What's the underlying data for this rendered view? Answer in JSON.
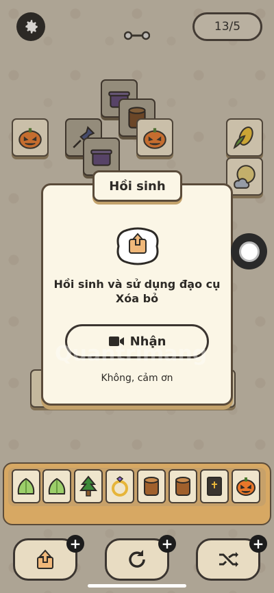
{
  "header": {
    "settings_icon": "gear-icon",
    "level_text": "13/5",
    "progress_icon": "link-progress-icon"
  },
  "board": {
    "tiles": [
      {
        "icon": "pumpkin-icon"
      },
      {
        "icon": "pot-icon"
      },
      {
        "icon": "log-icon"
      },
      {
        "icon": "pin-icon"
      },
      {
        "icon": "pot-icon"
      },
      {
        "icon": "pumpkin-icon"
      },
      {
        "icon": "corn-icon"
      },
      {
        "icon": "moon-cloud-icon"
      }
    ]
  },
  "modal": {
    "title": "Hồi sinh",
    "description": "Hồi sinh và sử dụng đạo cụ Xóa bỏ",
    "booster_icon": "undo-booster-icon",
    "receive_label": "Nhận",
    "receive_icon": "video-camera-icon",
    "decline_label": "Không, cảm ơn"
  },
  "tray": {
    "items": [
      {
        "icon": "lettuce-icon"
      },
      {
        "icon": "lettuce-icon"
      },
      {
        "icon": "tree-icon"
      },
      {
        "icon": "ring-icon"
      },
      {
        "icon": "log-icon"
      },
      {
        "icon": "log-icon"
      },
      {
        "icon": "book-icon"
      },
      {
        "icon": "pumpkin-icon"
      }
    ]
  },
  "tools": [
    {
      "name": "undo",
      "icon": "undo-icon",
      "badge": "+"
    },
    {
      "name": "refresh",
      "icon": "refresh-icon",
      "badge": "+"
    },
    {
      "name": "shuffle",
      "icon": "shuffle-icon",
      "badge": "+"
    }
  ],
  "watermark": "Quantrimang",
  "colors": {
    "background": "#c9c0b0",
    "panel": "#fbf6e6",
    "tray": "#d7a863",
    "dark": "#1c1c1c"
  }
}
